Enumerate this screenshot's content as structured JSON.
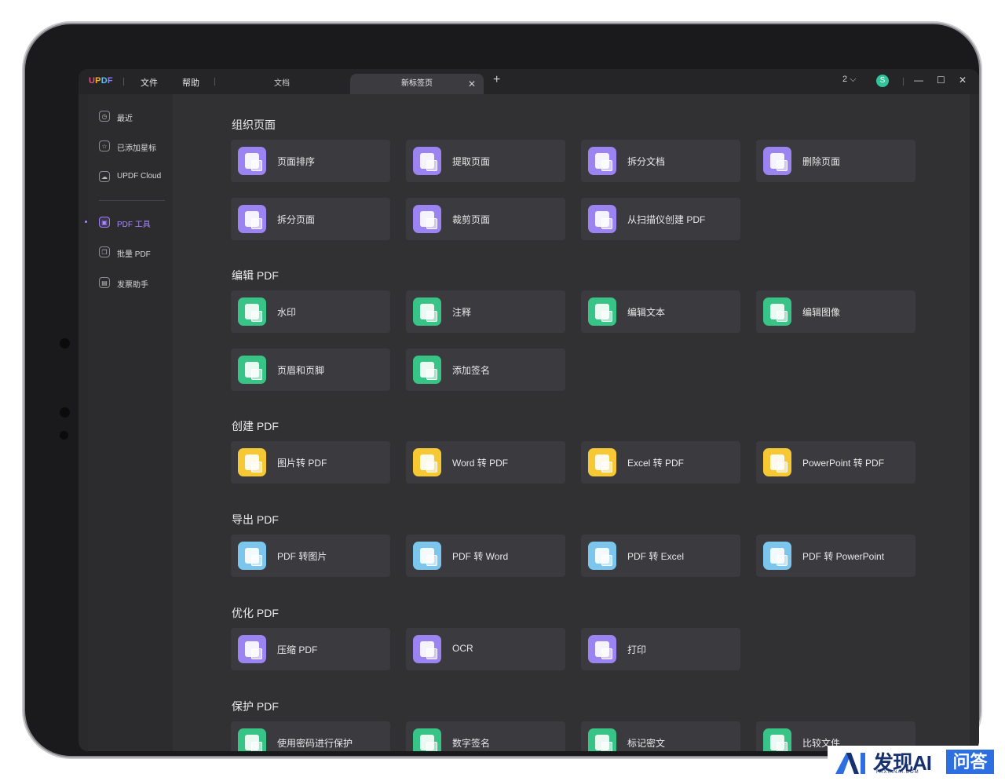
{
  "titlebar": {
    "logo": [
      "U",
      "P",
      "D",
      "F"
    ],
    "menu": [
      "文件",
      "帮助"
    ],
    "tabs": [
      {
        "label": "文档",
        "active": false
      },
      {
        "label": "新标签页",
        "active": true,
        "close": "✕"
      }
    ],
    "add_tab": "+",
    "page_count": "2",
    "avatar_letter": "S",
    "window_controls": {
      "minimize": "—",
      "maximize": "☐",
      "close": "✕"
    }
  },
  "sidebar": {
    "items": [
      {
        "label": "最近",
        "icon": "clock-icon"
      },
      {
        "label": "已添加星标",
        "icon": "star-icon"
      },
      {
        "label": "UPDF Cloud",
        "icon": "cloud-icon"
      },
      {
        "label": "PDF 工具",
        "icon": "toolbox-icon",
        "active": true
      },
      {
        "label": "批量 PDF",
        "icon": "batch-icon"
      },
      {
        "label": "发票助手",
        "icon": "invoice-icon"
      }
    ]
  },
  "sections": [
    {
      "title": "组织页面",
      "color": "purple",
      "tools": [
        "页面排序",
        "提取页面",
        "拆分文档",
        "删除页面",
        "拆分页面",
        "裁剪页面",
        "从扫描仪创建 PDF"
      ]
    },
    {
      "title": "编辑 PDF",
      "color": "green",
      "tools": [
        "水印",
        "注释",
        "编辑文本",
        "编辑图像",
        "页眉和页脚",
        "添加签名"
      ]
    },
    {
      "title": "创建 PDF",
      "color": "yellow",
      "tools": [
        "图片转 PDF",
        "Word 转 PDF",
        "Excel 转 PDF",
        "PowerPoint 转 PDF"
      ]
    },
    {
      "title": "导出 PDF",
      "color": "blue",
      "tools": [
        "PDF 转图片",
        "PDF 转 Word",
        "PDF 转 Excel",
        "PDF 转 PowerPoint"
      ]
    },
    {
      "title": "优化 PDF",
      "color": "purple",
      "tools": [
        "压缩 PDF",
        "OCR",
        "打印"
      ]
    },
    {
      "title": "保护 PDF",
      "color": "green",
      "tools": [
        "使用密码进行保护",
        "数字签名",
        "标记密文",
        "比较文件"
      ]
    }
  ],
  "watermark": {
    "brand": "发现AI",
    "sub": "FAXIANAI.COM",
    "tag": "问答"
  }
}
